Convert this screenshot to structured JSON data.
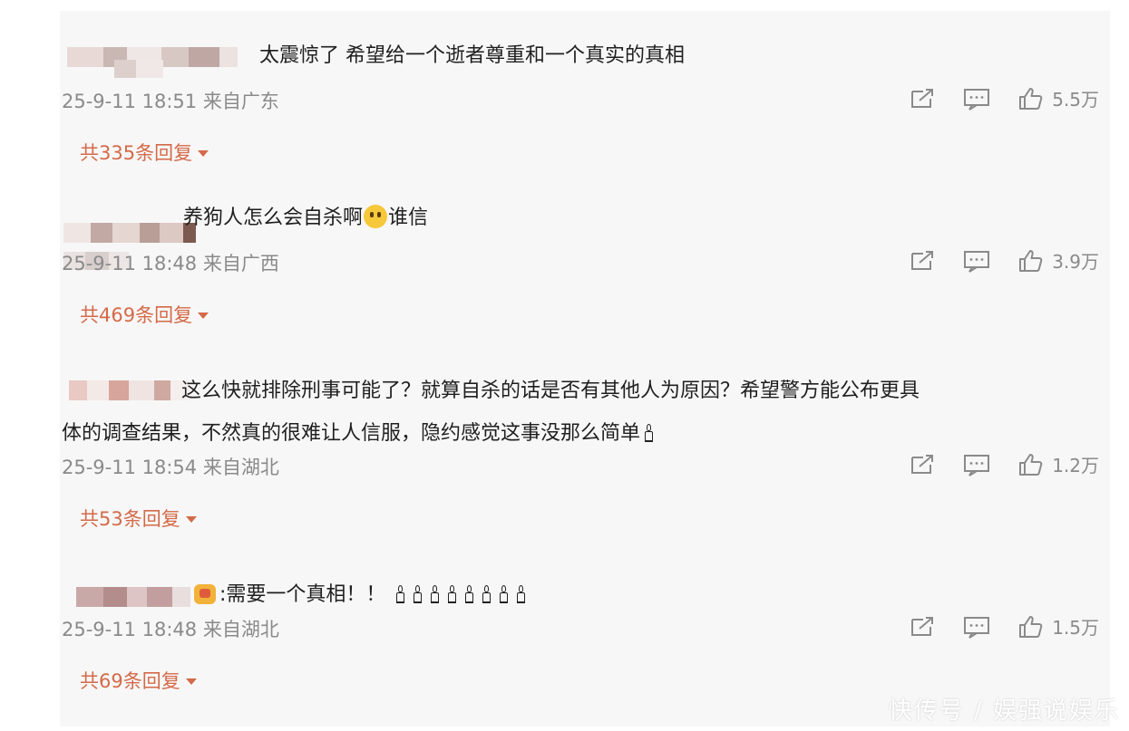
{
  "comments": [
    {
      "text": "太震惊了 希望给一个逝者尊重和一个真实的真相",
      "time": "25-9-11 18:51",
      "location": "来自广东",
      "likes": "5.5万",
      "replies": "共335条回复"
    },
    {
      "text_a": "养狗人怎么会自杀啊",
      "emoji": "shocked-face-emoji",
      "text_b": "谁信",
      "time": "25-9-11 18:48",
      "location": "来自广西",
      "likes": "3.9万",
      "replies": "共469条回复"
    },
    {
      "line1": "这么快就排除刑事可能了？就算自杀的话是否有其他人为原因？希望警方能公布更具",
      "line2": "体的调查结果，不然真的很难让人信服，隐约感觉这事没那么简单",
      "time": "25-9-11 18:54",
      "location": "来自湖北",
      "likes": "1.2万",
      "replies": "共53条回复"
    },
    {
      "text": ":需要一个真相！！",
      "time": "25-9-11 18:48",
      "location": "来自湖北",
      "likes": "1.5万",
      "replies": "共69条回复"
    }
  ],
  "icons": {
    "share": "share-icon",
    "comment": "comment-icon",
    "like": "thumbs-up-icon",
    "expand": "caret-down-icon",
    "candle": "candle-emoji"
  },
  "colors": {
    "reply_link": "#d46a49",
    "meta_text": "#8a8a8a",
    "background": "#f7f7f7"
  },
  "watermark": "快传号 / 娱强说娱乐"
}
